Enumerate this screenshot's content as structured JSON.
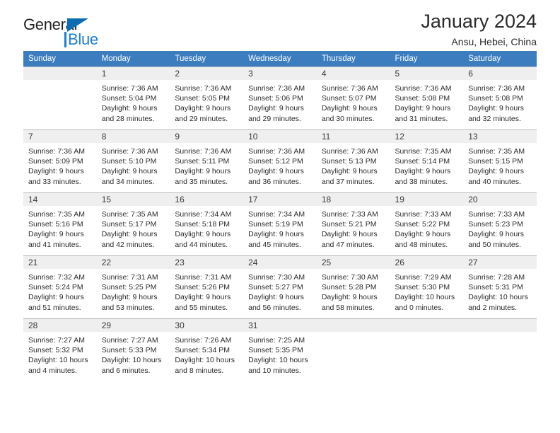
{
  "logo": {
    "primary_text": "General",
    "secondary_text": "Blue",
    "primary_color": "#231f20",
    "secondary_color": "#1b7fd4",
    "triangle_color": "#0b6cb3"
  },
  "header": {
    "title": "January 2024",
    "subtitle": "Ansu, Hebei, China"
  },
  "theme": {
    "header_row_bg": "#3c7dbf",
    "header_row_text": "#ffffff",
    "daynum_band_bg": "#efefef",
    "cell_bg": "#ffffff",
    "grid_line": "#b9b9b9"
  },
  "weekday_headers": [
    "Sunday",
    "Monday",
    "Tuesday",
    "Wednesday",
    "Thursday",
    "Friday",
    "Saturday"
  ],
  "weeks": [
    [
      {
        "day": "",
        "empty": true,
        "sunrise": "",
        "sunset": "",
        "daylight_line1": "",
        "daylight_line2": ""
      },
      {
        "day": "1",
        "empty": false,
        "sunrise": "Sunrise: 7:36 AM",
        "sunset": "Sunset: 5:04 PM",
        "daylight_line1": "Daylight: 9 hours",
        "daylight_line2": "and 28 minutes."
      },
      {
        "day": "2",
        "empty": false,
        "sunrise": "Sunrise: 7:36 AM",
        "sunset": "Sunset: 5:05 PM",
        "daylight_line1": "Daylight: 9 hours",
        "daylight_line2": "and 29 minutes."
      },
      {
        "day": "3",
        "empty": false,
        "sunrise": "Sunrise: 7:36 AM",
        "sunset": "Sunset: 5:06 PM",
        "daylight_line1": "Daylight: 9 hours",
        "daylight_line2": "and 29 minutes."
      },
      {
        "day": "4",
        "empty": false,
        "sunrise": "Sunrise: 7:36 AM",
        "sunset": "Sunset: 5:07 PM",
        "daylight_line1": "Daylight: 9 hours",
        "daylight_line2": "and 30 minutes."
      },
      {
        "day": "5",
        "empty": false,
        "sunrise": "Sunrise: 7:36 AM",
        "sunset": "Sunset: 5:08 PM",
        "daylight_line1": "Daylight: 9 hours",
        "daylight_line2": "and 31 minutes."
      },
      {
        "day": "6",
        "empty": false,
        "sunrise": "Sunrise: 7:36 AM",
        "sunset": "Sunset: 5:08 PM",
        "daylight_line1": "Daylight: 9 hours",
        "daylight_line2": "and 32 minutes."
      }
    ],
    [
      {
        "day": "7",
        "empty": false,
        "sunrise": "Sunrise: 7:36 AM",
        "sunset": "Sunset: 5:09 PM",
        "daylight_line1": "Daylight: 9 hours",
        "daylight_line2": "and 33 minutes."
      },
      {
        "day": "8",
        "empty": false,
        "sunrise": "Sunrise: 7:36 AM",
        "sunset": "Sunset: 5:10 PM",
        "daylight_line1": "Daylight: 9 hours",
        "daylight_line2": "and 34 minutes."
      },
      {
        "day": "9",
        "empty": false,
        "sunrise": "Sunrise: 7:36 AM",
        "sunset": "Sunset: 5:11 PM",
        "daylight_line1": "Daylight: 9 hours",
        "daylight_line2": "and 35 minutes."
      },
      {
        "day": "10",
        "empty": false,
        "sunrise": "Sunrise: 7:36 AM",
        "sunset": "Sunset: 5:12 PM",
        "daylight_line1": "Daylight: 9 hours",
        "daylight_line2": "and 36 minutes."
      },
      {
        "day": "11",
        "empty": false,
        "sunrise": "Sunrise: 7:36 AM",
        "sunset": "Sunset: 5:13 PM",
        "daylight_line1": "Daylight: 9 hours",
        "daylight_line2": "and 37 minutes."
      },
      {
        "day": "12",
        "empty": false,
        "sunrise": "Sunrise: 7:35 AM",
        "sunset": "Sunset: 5:14 PM",
        "daylight_line1": "Daylight: 9 hours",
        "daylight_line2": "and 38 minutes."
      },
      {
        "day": "13",
        "empty": false,
        "sunrise": "Sunrise: 7:35 AM",
        "sunset": "Sunset: 5:15 PM",
        "daylight_line1": "Daylight: 9 hours",
        "daylight_line2": "and 40 minutes."
      }
    ],
    [
      {
        "day": "14",
        "empty": false,
        "sunrise": "Sunrise: 7:35 AM",
        "sunset": "Sunset: 5:16 PM",
        "daylight_line1": "Daylight: 9 hours",
        "daylight_line2": "and 41 minutes."
      },
      {
        "day": "15",
        "empty": false,
        "sunrise": "Sunrise: 7:35 AM",
        "sunset": "Sunset: 5:17 PM",
        "daylight_line1": "Daylight: 9 hours",
        "daylight_line2": "and 42 minutes."
      },
      {
        "day": "16",
        "empty": false,
        "sunrise": "Sunrise: 7:34 AM",
        "sunset": "Sunset: 5:18 PM",
        "daylight_line1": "Daylight: 9 hours",
        "daylight_line2": "and 44 minutes."
      },
      {
        "day": "17",
        "empty": false,
        "sunrise": "Sunrise: 7:34 AM",
        "sunset": "Sunset: 5:19 PM",
        "daylight_line1": "Daylight: 9 hours",
        "daylight_line2": "and 45 minutes."
      },
      {
        "day": "18",
        "empty": false,
        "sunrise": "Sunrise: 7:33 AM",
        "sunset": "Sunset: 5:21 PM",
        "daylight_line1": "Daylight: 9 hours",
        "daylight_line2": "and 47 minutes."
      },
      {
        "day": "19",
        "empty": false,
        "sunrise": "Sunrise: 7:33 AM",
        "sunset": "Sunset: 5:22 PM",
        "daylight_line1": "Daylight: 9 hours",
        "daylight_line2": "and 48 minutes."
      },
      {
        "day": "20",
        "empty": false,
        "sunrise": "Sunrise: 7:33 AM",
        "sunset": "Sunset: 5:23 PM",
        "daylight_line1": "Daylight: 9 hours",
        "daylight_line2": "and 50 minutes."
      }
    ],
    [
      {
        "day": "21",
        "empty": false,
        "sunrise": "Sunrise: 7:32 AM",
        "sunset": "Sunset: 5:24 PM",
        "daylight_line1": "Daylight: 9 hours",
        "daylight_line2": "and 51 minutes."
      },
      {
        "day": "22",
        "empty": false,
        "sunrise": "Sunrise: 7:31 AM",
        "sunset": "Sunset: 5:25 PM",
        "daylight_line1": "Daylight: 9 hours",
        "daylight_line2": "and 53 minutes."
      },
      {
        "day": "23",
        "empty": false,
        "sunrise": "Sunrise: 7:31 AM",
        "sunset": "Sunset: 5:26 PM",
        "daylight_line1": "Daylight: 9 hours",
        "daylight_line2": "and 55 minutes."
      },
      {
        "day": "24",
        "empty": false,
        "sunrise": "Sunrise: 7:30 AM",
        "sunset": "Sunset: 5:27 PM",
        "daylight_line1": "Daylight: 9 hours",
        "daylight_line2": "and 56 minutes."
      },
      {
        "day": "25",
        "empty": false,
        "sunrise": "Sunrise: 7:30 AM",
        "sunset": "Sunset: 5:28 PM",
        "daylight_line1": "Daylight: 9 hours",
        "daylight_line2": "and 58 minutes."
      },
      {
        "day": "26",
        "empty": false,
        "sunrise": "Sunrise: 7:29 AM",
        "sunset": "Sunset: 5:30 PM",
        "daylight_line1": "Daylight: 10 hours",
        "daylight_line2": "and 0 minutes."
      },
      {
        "day": "27",
        "empty": false,
        "sunrise": "Sunrise: 7:28 AM",
        "sunset": "Sunset: 5:31 PM",
        "daylight_line1": "Daylight: 10 hours",
        "daylight_line2": "and 2 minutes."
      }
    ],
    [
      {
        "day": "28",
        "empty": false,
        "sunrise": "Sunrise: 7:27 AM",
        "sunset": "Sunset: 5:32 PM",
        "daylight_line1": "Daylight: 10 hours",
        "daylight_line2": "and 4 minutes."
      },
      {
        "day": "29",
        "empty": false,
        "sunrise": "Sunrise: 7:27 AM",
        "sunset": "Sunset: 5:33 PM",
        "daylight_line1": "Daylight: 10 hours",
        "daylight_line2": "and 6 minutes."
      },
      {
        "day": "30",
        "empty": false,
        "sunrise": "Sunrise: 7:26 AM",
        "sunset": "Sunset: 5:34 PM",
        "daylight_line1": "Daylight: 10 hours",
        "daylight_line2": "and 8 minutes."
      },
      {
        "day": "31",
        "empty": false,
        "sunrise": "Sunrise: 7:25 AM",
        "sunset": "Sunset: 5:35 PM",
        "daylight_line1": "Daylight: 10 hours",
        "daylight_line2": "and 10 minutes."
      },
      {
        "day": "",
        "empty": true,
        "sunrise": "",
        "sunset": "",
        "daylight_line1": "",
        "daylight_line2": ""
      },
      {
        "day": "",
        "empty": true,
        "sunrise": "",
        "sunset": "",
        "daylight_line1": "",
        "daylight_line2": ""
      },
      {
        "day": "",
        "empty": true,
        "sunrise": "",
        "sunset": "",
        "daylight_line1": "",
        "daylight_line2": ""
      }
    ]
  ]
}
